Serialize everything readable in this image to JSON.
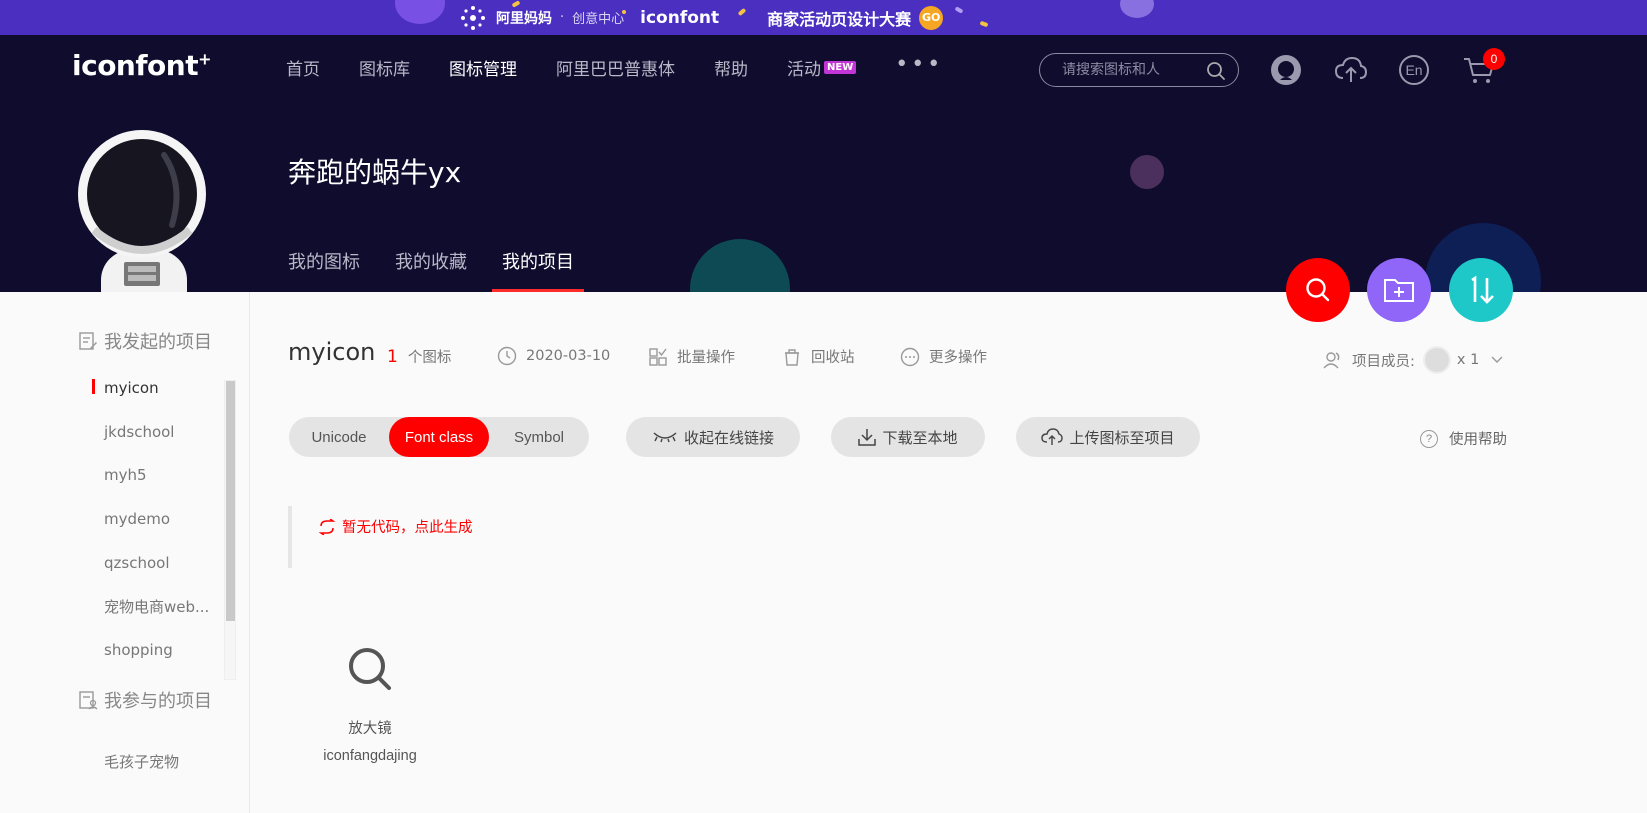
{
  "promo": {
    "alimama": "阿里妈妈",
    "separator": "·",
    "creative_center": "创意中心",
    "logo": "iconfont",
    "campaign": "商家活动页设计大赛",
    "go": "GO"
  },
  "header": {
    "logo": "iconfont",
    "logo_plus": "+",
    "nav": [
      "首页",
      "图标库",
      "图标管理",
      "阿里巴巴普惠体",
      "帮助",
      "活动"
    ],
    "nav_active": "图标管理",
    "new_badge": "NEW",
    "more": "•••",
    "search_placeholder": "请搜索图标和人",
    "lang": "En",
    "cart_count": "0"
  },
  "profile": {
    "name": "奔跑的蜗牛yx",
    "tabs": [
      "我的图标",
      "我的收藏",
      "我的项目"
    ],
    "active_tab": "我的项目"
  },
  "sidebar": {
    "my_projects_title": "我发起的项目",
    "my_projects": [
      "myicon",
      "jkdschool",
      "myh5",
      "mydemo",
      "qzschool",
      "宠物电商web...",
      "shopping"
    ],
    "active_project": "myicon",
    "joined_title": "我参与的项目",
    "joined_projects": [
      "毛孩子宠物"
    ]
  },
  "project": {
    "title": "myicon",
    "icon_count": "1",
    "icon_count_label": "个图标",
    "date": "2020-03-10",
    "batch": "批量操作",
    "recycle": "回收站",
    "more_ops": "更多操作",
    "members_label": "项目成员:",
    "members_count": "x 1"
  },
  "toolbar": {
    "formats": [
      "Unicode",
      "Font class",
      "Symbol"
    ],
    "active_format": "Font class",
    "collapse_link": "收起在线链接",
    "download": "下载至本地",
    "upload": "上传图标至项目",
    "help": "使用帮助"
  },
  "code": {
    "generate": "暂无代码，点此生成"
  },
  "icons": [
    {
      "name": "放大镜",
      "code": "iconfangdajing",
      "icon": "magnifier-icon"
    }
  ],
  "colors": {
    "accent": "#ff0000",
    "header_bg": "#0f0c2d",
    "promo_bg": "#4a2fc0",
    "fab_purple": "#8f66f7",
    "fab_teal": "#1ec8c8"
  }
}
